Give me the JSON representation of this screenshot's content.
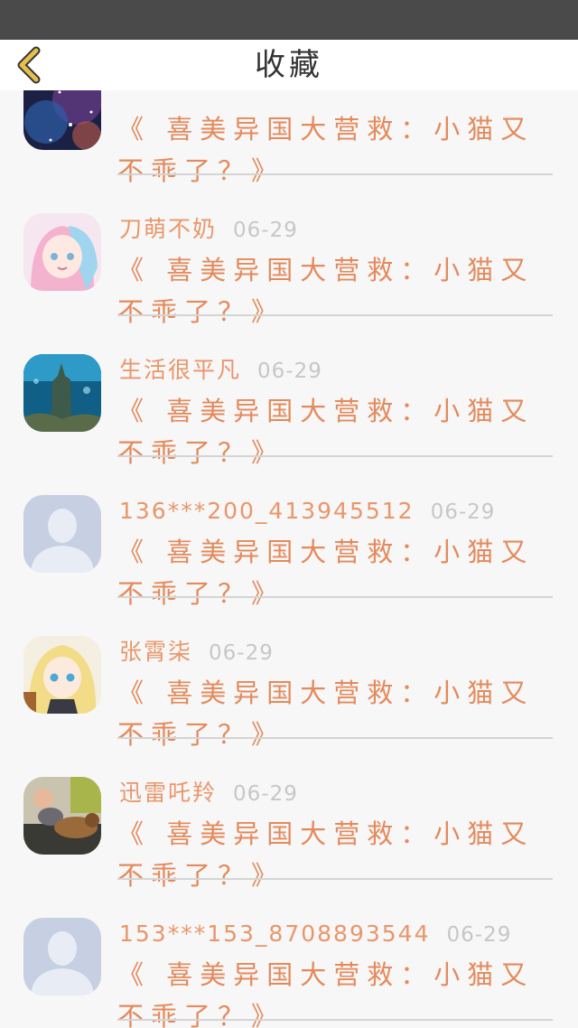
{
  "nav": {
    "title": "收藏"
  },
  "colors": {
    "accent": "#e48a5c",
    "date": "#c7c7c7",
    "divider": "#d4d4d4",
    "back_arrow": "#e6c04a"
  },
  "items": [
    {
      "avatar": "space-avatar",
      "username": "",
      "date": "",
      "title": "《 喜美异国大营救：小猫又不乖了？》"
    },
    {
      "avatar": "anime-girl-pink-avatar",
      "username": "刀萌不奶",
      "date": "06-29",
      "title": "《 喜美异国大营救：小猫又不乖了？》"
    },
    {
      "avatar": "underwater-castle-avatar",
      "username": "生活很平凡",
      "date": "06-29",
      "title": "《 喜美异国大营救：小猫又不乖了？》"
    },
    {
      "avatar": "default-user-avatar",
      "username": "136***200_413945512",
      "date": "06-29",
      "title": "《 喜美异国大营救：小猫又不乖了？》"
    },
    {
      "avatar": "anime-girl-blonde-avatar",
      "username": "张霄柒",
      "date": "06-29",
      "title": "《 喜美异国大营救：小猫又不乖了？》"
    },
    {
      "avatar": "baby-dog-photo-avatar",
      "username": "迅雷吒羚",
      "date": "06-29",
      "title": "《 喜美异国大营救：小猫又不乖了？》"
    },
    {
      "avatar": "default-user-avatar",
      "username": "153***153_8708893544",
      "date": "06-29",
      "title": "《 喜美异国大营救：小猫又不乖了？》"
    }
  ]
}
